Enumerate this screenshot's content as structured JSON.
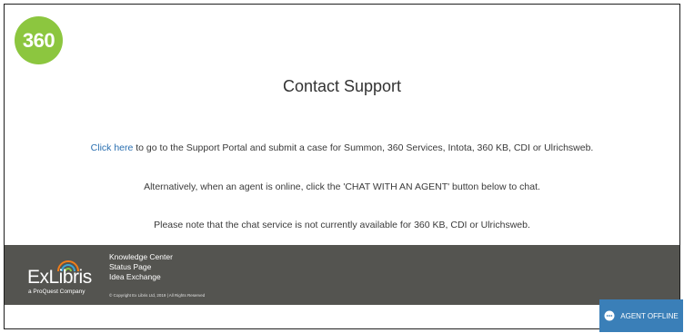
{
  "logo": {
    "text": "360",
    "color": "#8cc63f"
  },
  "main": {
    "title": "Contact Support",
    "link_text": "Click here",
    "line1_rest": " to go to the Support Portal and submit a case for Summon, 360 Services, Intota, 360 KB, CDI or Ulrichsweb.",
    "line2": "Alternatively, when an agent is online, click the 'CHAT WITH AN AGENT' button below to chat.",
    "line3": "Please note that the chat service is not currently available for 360 KB, CDI or Ulrichsweb."
  },
  "footer": {
    "brand": "ExLibris",
    "brand_sub": "a ProQuest Company",
    "links": [
      "Knowledge Center",
      "Status Page",
      "Idea Exchange"
    ],
    "copyright": "© Copyright Ex Libris Ltd, 2019   |   All Rights Reserved",
    "background": "#545450"
  },
  "agent_button": {
    "label": "AGENT OFFLINE",
    "icon": "chat-bubble-icon",
    "color": "#3a7fb8"
  }
}
